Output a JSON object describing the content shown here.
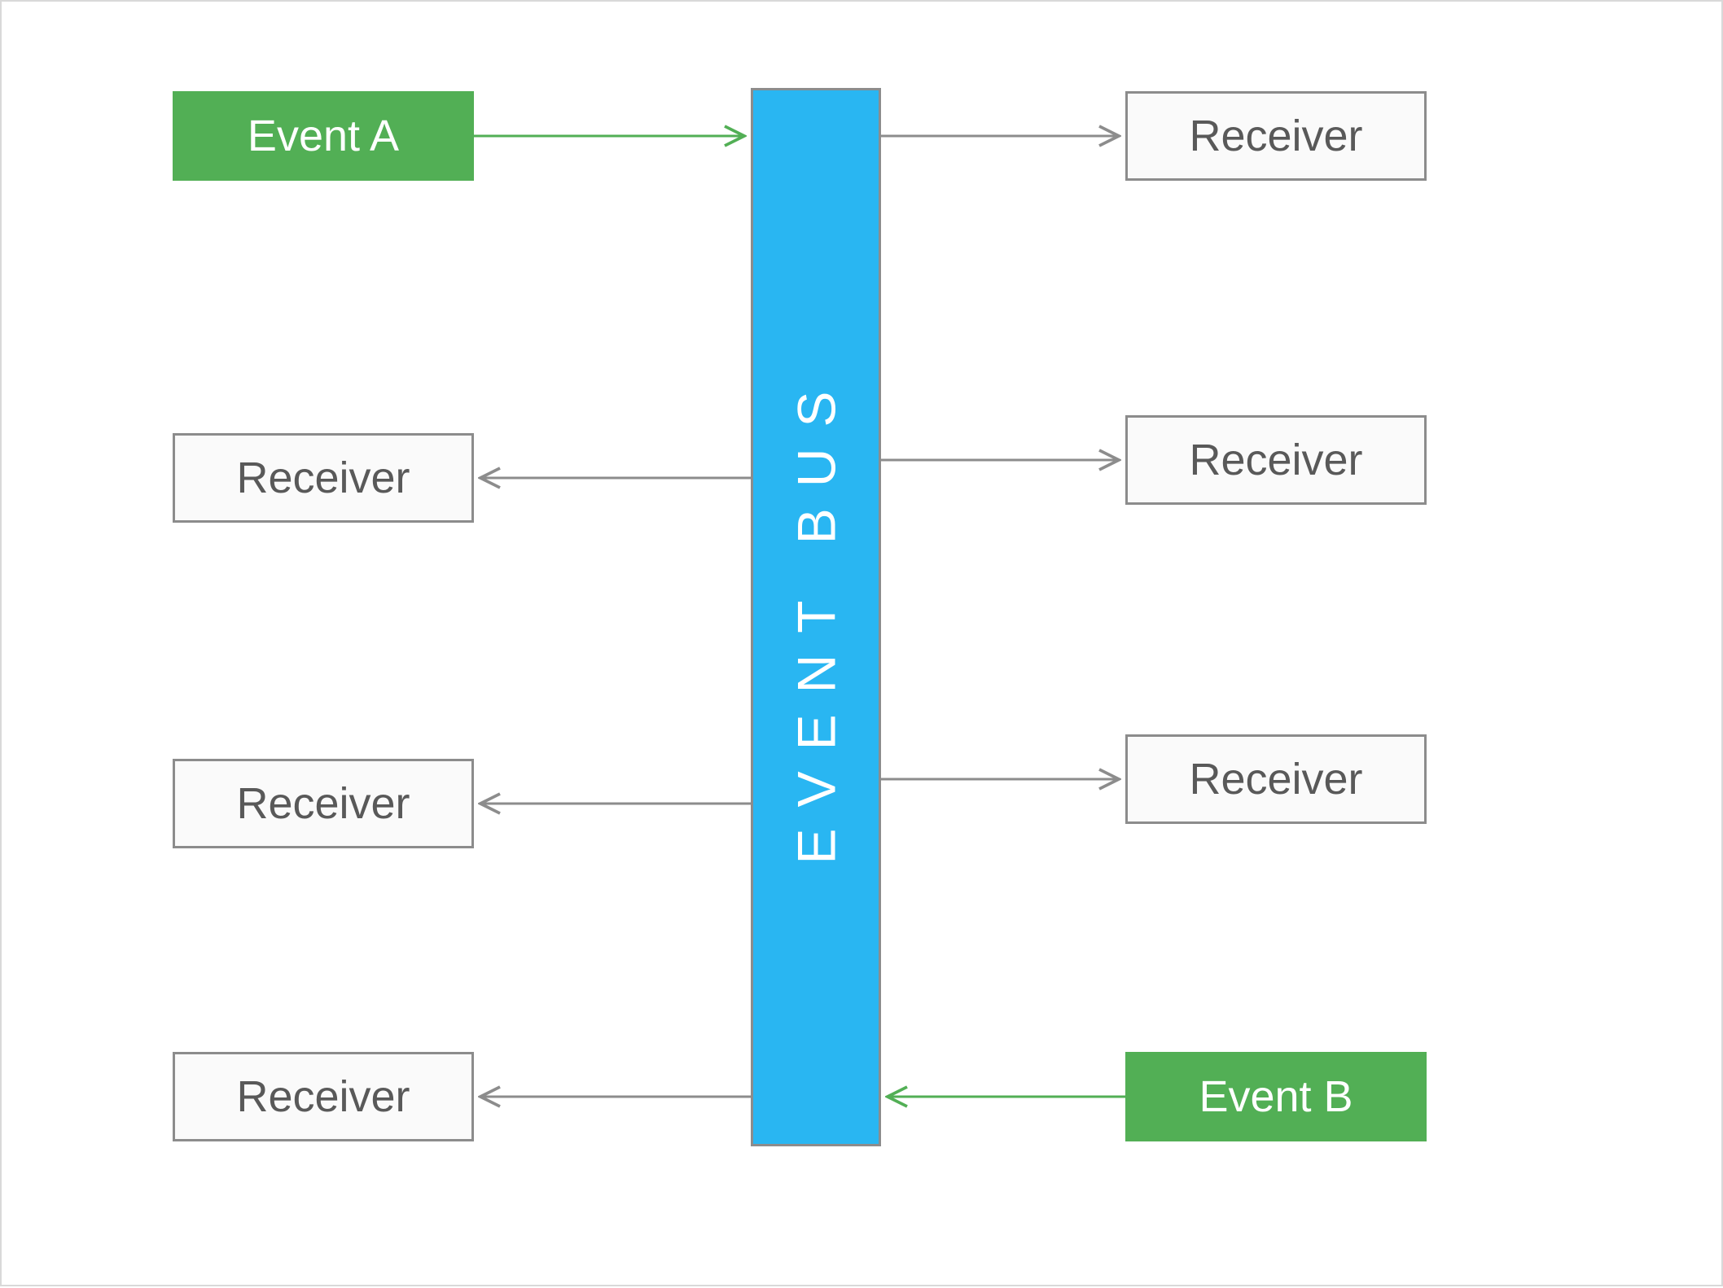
{
  "bus": {
    "label": "EVENT BUS"
  },
  "left": {
    "row1": {
      "label": "Event  A",
      "type": "event"
    },
    "row2": {
      "label": "Receiver",
      "type": "receiver"
    },
    "row3": {
      "label": "Receiver",
      "type": "receiver"
    },
    "row4": {
      "label": "Receiver",
      "type": "receiver"
    }
  },
  "right": {
    "row1": {
      "label": "Receiver",
      "type": "receiver"
    },
    "row2": {
      "label": "Receiver",
      "type": "receiver"
    },
    "row3": {
      "label": "Receiver",
      "type": "receiver"
    },
    "row4": {
      "label": "Event B",
      "type": "event"
    }
  },
  "colors": {
    "event_bg": "#52af55",
    "bus_bg": "#29b6f2",
    "box_border": "#8c8c8c",
    "box_bg": "#fafafa",
    "arrow_gray": "#8c8c8c",
    "arrow_green": "#52af55"
  },
  "layout_note": "Event boxes publish into the bus (green arrows). Receiver boxes subscribe from the bus (gray arrows pointing outward)."
}
